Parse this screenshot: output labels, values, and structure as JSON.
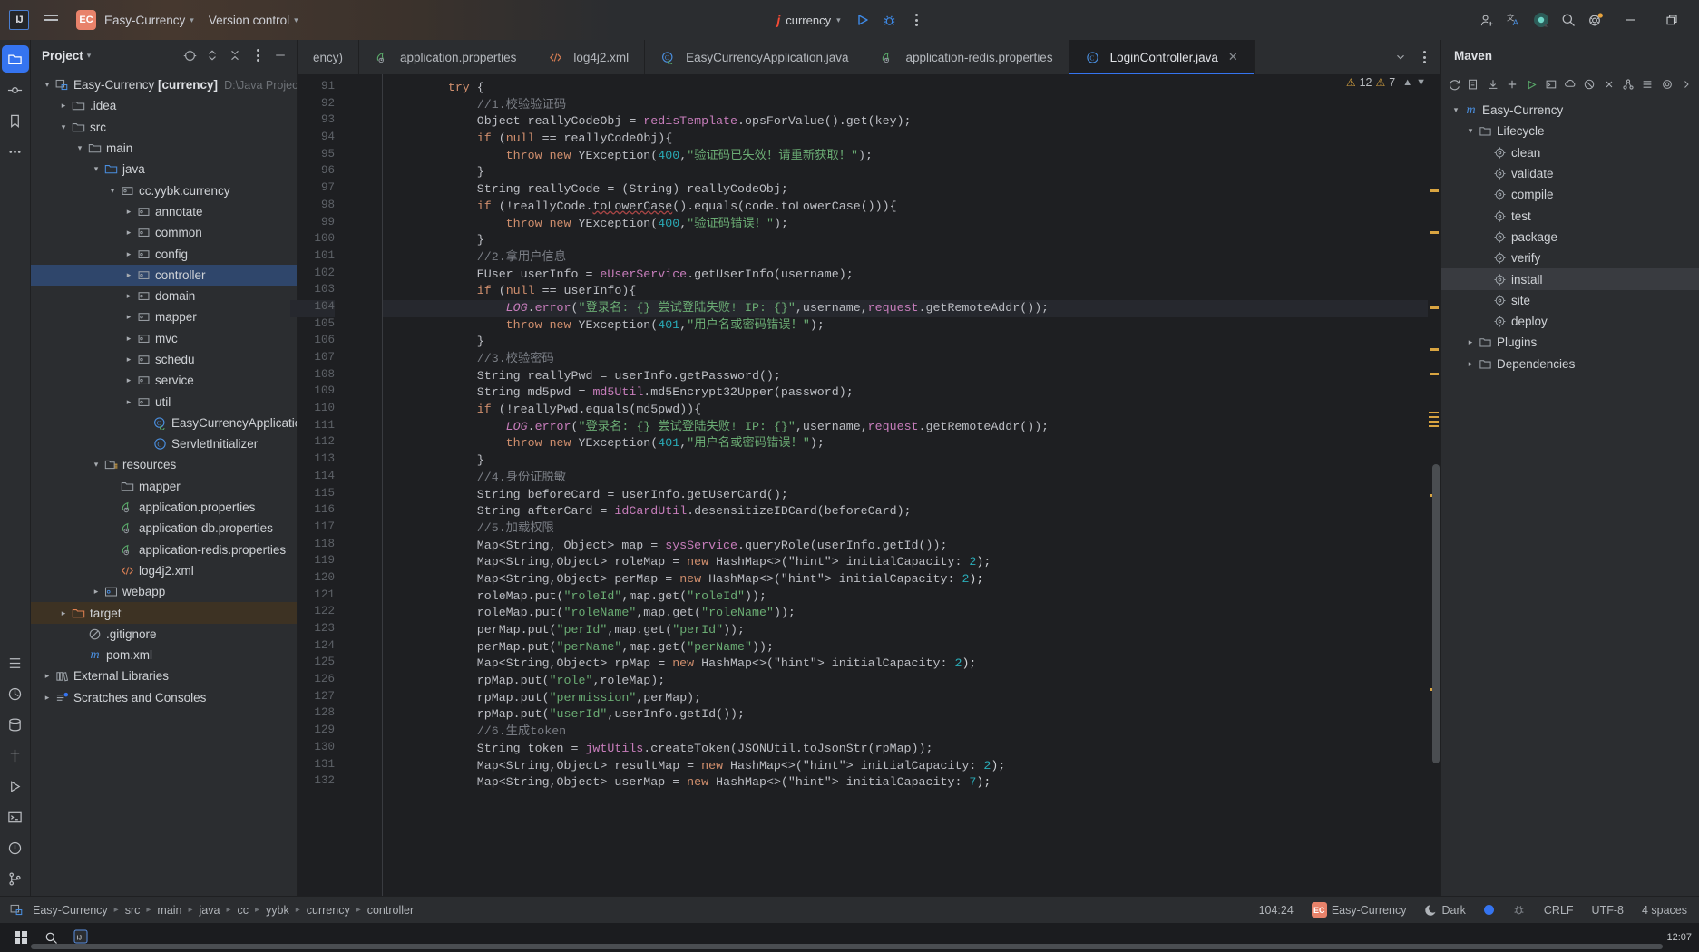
{
  "titlebar": {
    "logo_alt": "IJ",
    "project_badge": "EC",
    "project_name": "Easy-Currency",
    "vcs_label": "Version control",
    "run_config": "currency"
  },
  "project_panel": {
    "title": "Project",
    "tree": [
      {
        "depth": 0,
        "arrow": "down",
        "icon": "module-icon",
        "label": "Easy-Currency",
        "bold": "[currency]",
        "path": "D:\\Java Project\\Jss Pro"
      },
      {
        "depth": 1,
        "arrow": "right",
        "icon": "folder-icon",
        "label": ".idea"
      },
      {
        "depth": 1,
        "arrow": "down",
        "icon": "folder-icon",
        "label": "src"
      },
      {
        "depth": 2,
        "arrow": "down",
        "icon": "folder-icon",
        "label": "main"
      },
      {
        "depth": 3,
        "arrow": "down",
        "icon": "source-root-icon",
        "label": "java"
      },
      {
        "depth": 4,
        "arrow": "down",
        "icon": "package-icon",
        "label": "cc.yybk.currency"
      },
      {
        "depth": 5,
        "arrow": "right",
        "icon": "package-icon",
        "label": "annotate"
      },
      {
        "depth": 5,
        "arrow": "right",
        "icon": "package-icon",
        "label": "common"
      },
      {
        "depth": 5,
        "arrow": "right",
        "icon": "package-icon",
        "label": "config"
      },
      {
        "depth": 5,
        "arrow": "right",
        "icon": "package-icon",
        "label": "controller",
        "selected": true
      },
      {
        "depth": 5,
        "arrow": "right",
        "icon": "package-icon",
        "label": "domain"
      },
      {
        "depth": 5,
        "arrow": "right",
        "icon": "package-icon",
        "label": "mapper"
      },
      {
        "depth": 5,
        "arrow": "right",
        "icon": "package-icon",
        "label": "mvc"
      },
      {
        "depth": 5,
        "arrow": "right",
        "icon": "package-icon",
        "label": "schedu"
      },
      {
        "depth": 5,
        "arrow": "right",
        "icon": "package-icon",
        "label": "service"
      },
      {
        "depth": 5,
        "arrow": "right",
        "icon": "package-icon",
        "label": "util"
      },
      {
        "depth": 6,
        "arrow": "none",
        "icon": "spring-class-icon",
        "label": "EasyCurrencyApplication"
      },
      {
        "depth": 6,
        "arrow": "none",
        "icon": "java-class-icon",
        "label": "ServletInitializer"
      },
      {
        "depth": 3,
        "arrow": "down",
        "icon": "resource-root-icon",
        "label": "resources"
      },
      {
        "depth": 4,
        "arrow": "none",
        "icon": "folder-icon",
        "label": "mapper"
      },
      {
        "depth": 4,
        "arrow": "none",
        "icon": "properties-icon",
        "label": "application.properties"
      },
      {
        "depth": 4,
        "arrow": "none",
        "icon": "properties-icon",
        "label": "application-db.properties"
      },
      {
        "depth": 4,
        "arrow": "none",
        "icon": "properties-icon",
        "label": "application-redis.properties"
      },
      {
        "depth": 4,
        "arrow": "none",
        "icon": "xml-icon",
        "label": "log4j2.xml"
      },
      {
        "depth": 3,
        "arrow": "right",
        "icon": "webapp-icon",
        "label": "webapp"
      },
      {
        "depth": 1,
        "arrow": "right",
        "icon": "excluded-folder-icon",
        "label": "target",
        "marked": true
      },
      {
        "depth": 2,
        "arrow": "none",
        "icon": "gitignore-icon",
        "label": ".gitignore"
      },
      {
        "depth": 2,
        "arrow": "none",
        "icon": "maven-icon",
        "label": "pom.xml"
      },
      {
        "depth": 0,
        "arrow": "right",
        "icon": "library-icon",
        "label": "External Libraries"
      },
      {
        "depth": 0,
        "arrow": "right",
        "icon": "scratches-icon",
        "label": "Scratches and Consoles"
      }
    ]
  },
  "editor": {
    "tabs": [
      {
        "label": "ency)",
        "icon": "none",
        "truncated": true
      },
      {
        "label": "application.properties",
        "icon": "properties-icon"
      },
      {
        "label": "log4j2.xml",
        "icon": "xml-icon"
      },
      {
        "label": "EasyCurrencyApplication.java",
        "icon": "spring-class-icon"
      },
      {
        "label": "application-redis.properties",
        "icon": "properties-icon"
      },
      {
        "label": "LoginController.java",
        "icon": "java-class-icon",
        "active": true,
        "closable": true
      }
    ],
    "inspections": {
      "warnings": "12",
      "weak_warnings": "7"
    },
    "first_line_number": 91,
    "current_line_number": 104,
    "lines": [
      "        try {",
      "            //1.校验验证码",
      "            Object reallyCodeObj = redisTemplate.opsForValue().get(key);",
      "            if (null == reallyCodeObj){",
      "                throw new YException(400,\"验证码已失效！请重新获取！\");",
      "            }",
      "            String reallyCode = (String) reallyCodeObj;",
      "            if (!reallyCode.toLowerCase().equals(code.toLowerCase())){",
      "                throw new YException(400,\"验证码错误！\");",
      "            }",
      "            //2.拿用户信息",
      "            EUser userInfo = eUserService.getUserInfo(username);",
      "            if (null == userInfo){",
      "                LOG.error(\"登录名: {} 尝试登陆失败! IP: {}\",username,request.getRemoteAddr());",
      "                throw new YException(401,\"用户名或密码错误！\");",
      "            }",
      "            //3.校验密码",
      "            String reallyPwd = userInfo.getPassword();",
      "            String md5pwd = md5Util.md5Encrypt32Upper(password);",
      "            if (!reallyPwd.equals(md5pwd)){",
      "                LOG.error(\"登录名: {} 尝试登陆失败! IP: {}\",username,request.getRemoteAddr());",
      "                throw new YException(401,\"用户名或密码错误！\");",
      "            }",
      "            //4.身份证脱敏",
      "            String beforeCard = userInfo.getUserCard();",
      "            String afterCard = idCardUtil.desensitizeIDCard(beforeCard);",
      "            //5.加载权限",
      "            Map<String, Object> map = sysService.queryRole(userInfo.getId());",
      "            Map<String,Object> roleMap = new HashMap<>( initialCapacity: 2);",
      "            Map<String,Object> perMap = new HashMap<>( initialCapacity: 2);",
      "            roleMap.put(\"roleId\",map.get(\"roleId\"));",
      "            roleMap.put(\"roleName\",map.get(\"roleName\"));",
      "            perMap.put(\"perId\",map.get(\"perId\"));",
      "            perMap.put(\"perName\",map.get(\"perName\"));",
      "            Map<String,Object> rpMap = new HashMap<>( initialCapacity: 2);",
      "            rpMap.put(\"role\",roleMap);",
      "            rpMap.put(\"permission\",perMap);",
      "            rpMap.put(\"userId\",userInfo.getId());",
      "            //6.生成token",
      "            String token = jwtUtils.createToken(JSONUtil.toJsonStr(rpMap));",
      "            Map<String,Object> resultMap = new HashMap<>( initialCapacity: 2);",
      "            Map<String,Object> userMap = new HashMap<>( initialCapacity: 7);"
    ]
  },
  "maven": {
    "title": "Maven",
    "toolbar_icons": [
      "reload-icon",
      "add-module-icon",
      "download-sources-icon",
      "add-icon",
      "run-icon",
      "execute-goal-icon",
      "toggle-offline-icon",
      "skip-tests-icon",
      "collapse-icon",
      "show-diagram-icon",
      "expand-icon",
      "settings-icon",
      "more-icon"
    ],
    "tree": [
      {
        "depth": 0,
        "arrow": "down",
        "icon": "maven-icon",
        "label": "Easy-Currency"
      },
      {
        "depth": 1,
        "arrow": "down",
        "icon": "lifecycle-icon",
        "label": "Lifecycle"
      },
      {
        "depth": 2,
        "arrow": "none",
        "icon": "goal-icon",
        "label": "clean"
      },
      {
        "depth": 2,
        "arrow": "none",
        "icon": "goal-icon",
        "label": "validate"
      },
      {
        "depth": 2,
        "arrow": "none",
        "icon": "goal-icon",
        "label": "compile"
      },
      {
        "depth": 2,
        "arrow": "none",
        "icon": "goal-icon",
        "label": "test"
      },
      {
        "depth": 2,
        "arrow": "none",
        "icon": "goal-icon",
        "label": "package"
      },
      {
        "depth": 2,
        "arrow": "none",
        "icon": "goal-icon",
        "label": "verify"
      },
      {
        "depth": 2,
        "arrow": "none",
        "icon": "goal-icon",
        "label": "install",
        "selected": true
      },
      {
        "depth": 2,
        "arrow": "none",
        "icon": "goal-icon",
        "label": "site"
      },
      {
        "depth": 2,
        "arrow": "none",
        "icon": "goal-icon",
        "label": "deploy"
      },
      {
        "depth": 1,
        "arrow": "right",
        "icon": "plugins-icon",
        "label": "Plugins"
      },
      {
        "depth": 1,
        "arrow": "right",
        "icon": "plugins-icon",
        "label": "Dependencies"
      }
    ]
  },
  "status_bar": {
    "breadcrumbs": [
      "Easy-Currency",
      "src",
      "main",
      "java",
      "cc",
      "yybk",
      "currency",
      "controller"
    ],
    "caret_position": "104:24",
    "project_badge": "EC",
    "project_name": "Easy-Currency",
    "theme": "Dark",
    "line_separator": "CRLF",
    "encoding": "UTF-8",
    "indent": "4 spaces"
  },
  "taskbar": {
    "time": "12:07"
  },
  "colors": {
    "accent": "#3574f0",
    "warning": "#d9a441",
    "badge": "#e8826a",
    "selection": "#2f466b",
    "editor_bg": "#1e1f22",
    "panel_bg": "#2b2d30"
  }
}
